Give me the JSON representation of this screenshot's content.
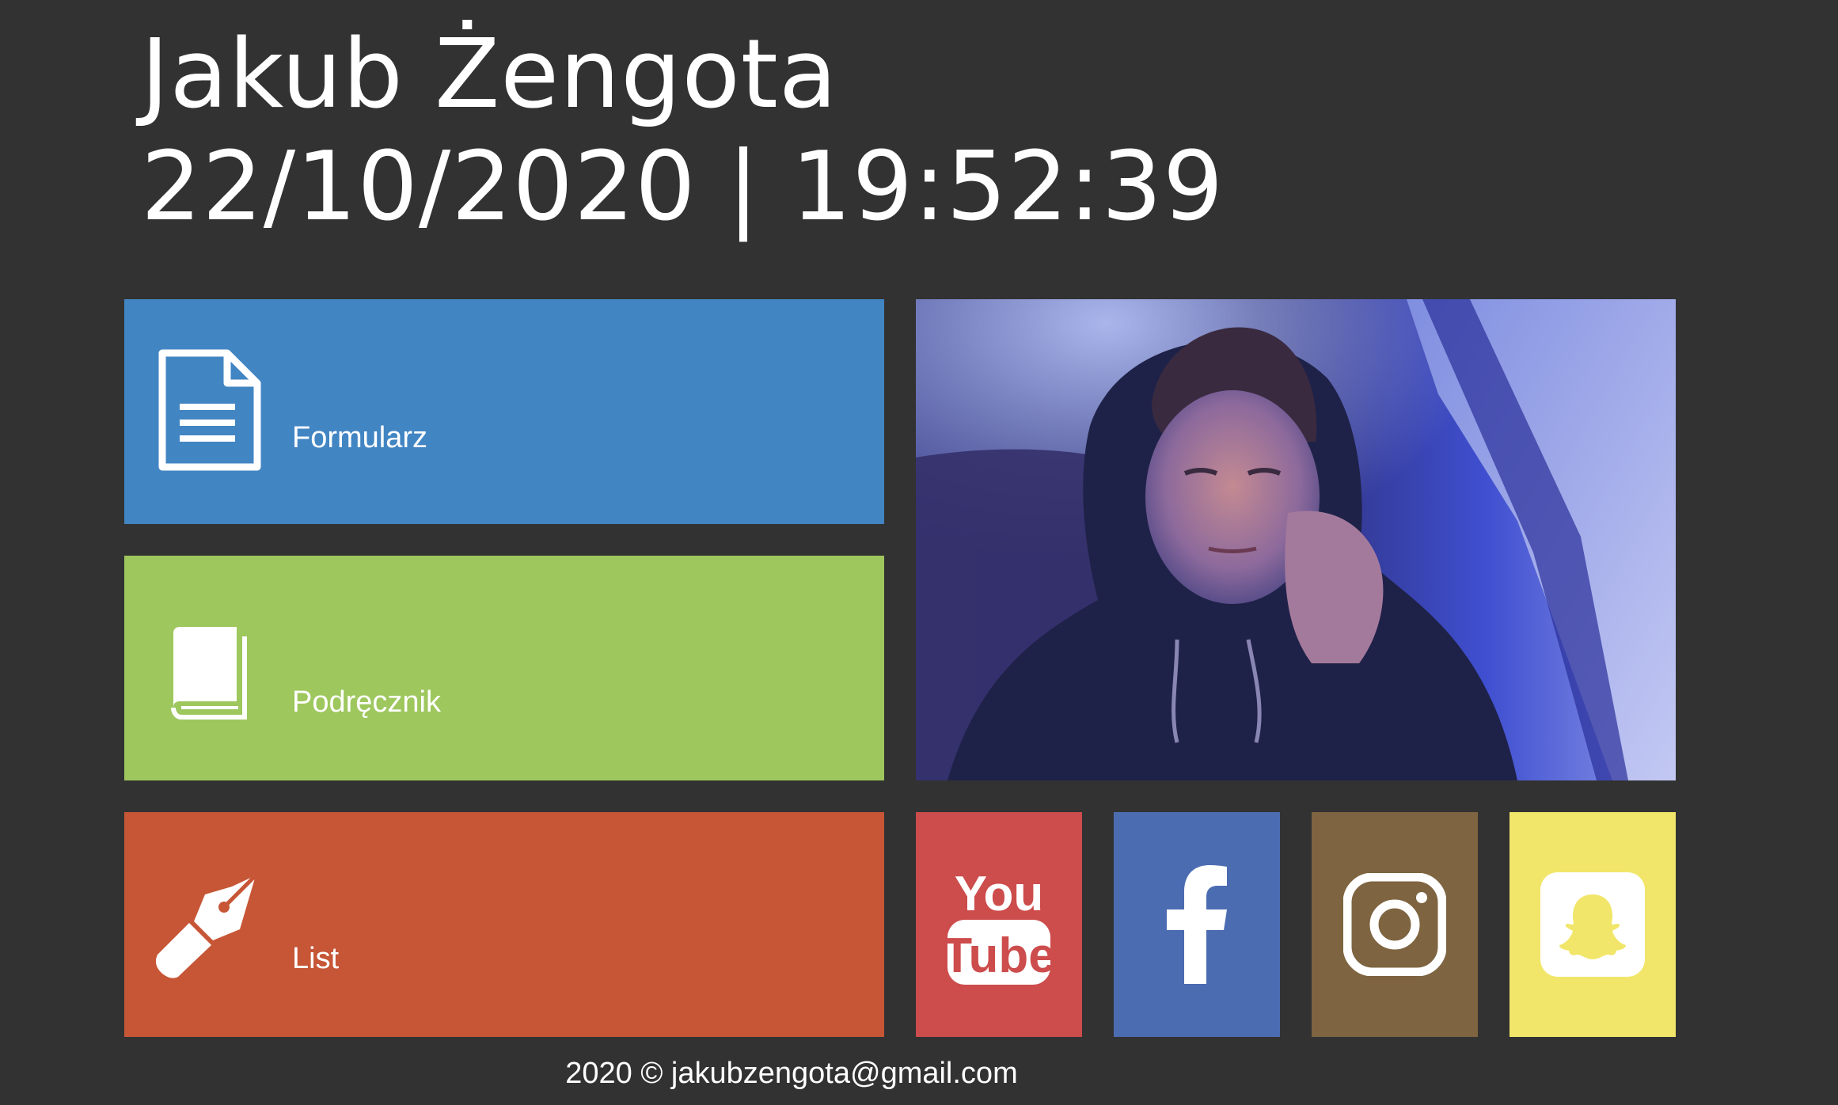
{
  "header": {
    "name": "Jakub Żengota",
    "clock": "22/10/2020 | 19:52:39"
  },
  "tiles": [
    {
      "label": "Formularz",
      "icon": "document-icon",
      "color": "#4285c3"
    },
    {
      "label": "Podręcznik",
      "icon": "book-icon",
      "color": "#9ec75e"
    },
    {
      "label": "List",
      "icon": "fountain-pen-icon",
      "color": "#c65636"
    }
  ],
  "social": [
    {
      "name": "YouTube",
      "icon": "youtube-icon",
      "color": "#cd4c4c",
      "logo_text_top": "You",
      "logo_text_bottom": "Tube"
    },
    {
      "name": "Facebook",
      "icon": "facebook-icon",
      "color": "#4c6cb2"
    },
    {
      "name": "Instagram",
      "icon": "instagram-icon",
      "color": "#7e6440"
    },
    {
      "name": "Snapchat",
      "icon": "snapchat-icon",
      "color": "#f1e66a"
    }
  ],
  "footer": {
    "year": "2020",
    "copyright": "©",
    "email": "jakubzengota@gmail.com"
  }
}
